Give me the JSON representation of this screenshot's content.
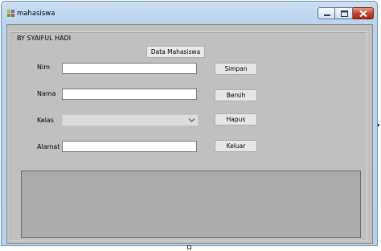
{
  "window": {
    "title": "mahasiswa",
    "app_icon": "winforms-app-icon",
    "controls": [
      "minimize-icon",
      "maximize-icon",
      "close-icon"
    ]
  },
  "form": {
    "group_title": "BY SYAIFUL HADI",
    "header_button": "Data Mahasiswa",
    "fields": {
      "nim": {
        "label": "Nim",
        "value": ""
      },
      "nama": {
        "label": "Nama",
        "value": ""
      },
      "kelas": {
        "label": "Kelas",
        "selected": ""
      },
      "alamat": {
        "label": "Alamat",
        "value": ""
      }
    },
    "buttons": {
      "simpan": "Simpan",
      "bersih": "Bersih",
      "hapus": "Hapus",
      "keluar": "Keluar"
    }
  },
  "colors": {
    "title_bar": "#b9d3ee",
    "form_background": "#c0c0c0",
    "grid_background": "#ababab",
    "close_button": "#c8452a"
  }
}
